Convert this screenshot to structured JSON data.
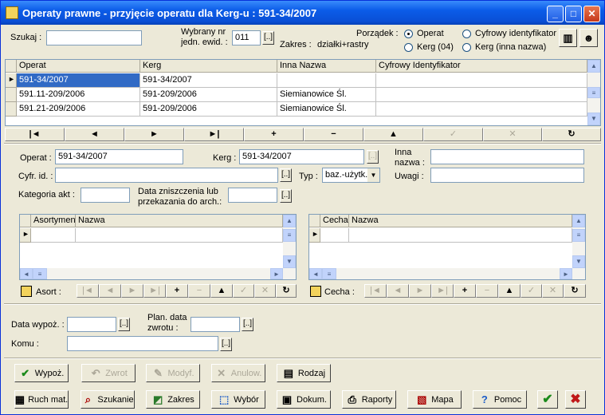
{
  "window": {
    "title": "Operaty prawne - przyjęcie operatu dla Kerg-u :  591-34/2007"
  },
  "top": {
    "search_label": "Szukaj :",
    "search_value": "",
    "unit_label1": "Wybrany nr",
    "unit_label2": "jedn. ewid. :",
    "unit_value": "011",
    "unit_btn": "[..]",
    "scope_label": "Zakres :",
    "scope_value": "działki+rastry",
    "order_label": "Porządek :",
    "order_options": [
      "Operat",
      "Kerg (04)",
      "Cyfrowy identyfikator",
      "Kerg (inna nazwa)"
    ]
  },
  "main_grid": {
    "columns": [
      "Operat",
      "Kerg",
      "Inna Nazwa",
      "Cyfrowy Identyfikator"
    ],
    "rows": [
      [
        "591-34/2007",
        "591-34/2007",
        "",
        ""
      ],
      [
        "591.11-209/2006",
        "591-209/2006",
        "Siemianowice Śl.",
        ""
      ],
      [
        "591.21-209/2006",
        "591-209/2006",
        "Siemianowice Śl.",
        ""
      ]
    ]
  },
  "nav": [
    "|◄",
    "◄",
    "►",
    "►|",
    "+",
    "−",
    "▲",
    "✓",
    "✕",
    "↻"
  ],
  "form": {
    "operat_label": "Operat :",
    "operat_value": "591-34/2007",
    "kerg_label": "Kerg :",
    "kerg_value": "591-34/2007",
    "inna_label1": "Inna",
    "inna_label2": "nazwa :",
    "inna_value": "",
    "cyfr_label": "Cyfr. id. :",
    "cyfr_value": "",
    "typ_label": "Typ :",
    "typ_value": "baz.-użytk.",
    "uwagi_label": "Uwagi :",
    "uwagi_value": "",
    "kat_label": "Kategoria akt :",
    "kat_value": "",
    "zn_label1": "Data zniszczenia lub",
    "zn_label2": "przekazania do arch.:",
    "zn_value": "",
    "dots": "[..]"
  },
  "asort_grid": {
    "columns": [
      "Asortyment",
      "Nazwa"
    ],
    "label": "Asort :"
  },
  "cecha_grid": {
    "columns": [
      "Cecha",
      "Nazwa"
    ],
    "label": "Cecha :"
  },
  "loan": {
    "date_label": "Data wypoż. :",
    "date_value": "",
    "plan_label1": "Plan. data",
    "plan_label2": "zwrotu :",
    "plan_value": "",
    "komu_label": "Komu :",
    "komu_value": ""
  },
  "buttons_row1": [
    "Wypoż.",
    "Zwrot",
    "Modyf.",
    "Anulow.",
    "Rodzaj"
  ],
  "buttons_row2": [
    "Ruch mat.",
    "Szukanie",
    "Zakres",
    "Wybór",
    "Dokum.",
    "Raporty",
    "Mapa",
    "Pomoc"
  ],
  "colors": {
    "title": "#0a4fd6",
    "selection": "#316ac5",
    "ok": "#1a8a1a",
    "cancel": "#c01818"
  }
}
